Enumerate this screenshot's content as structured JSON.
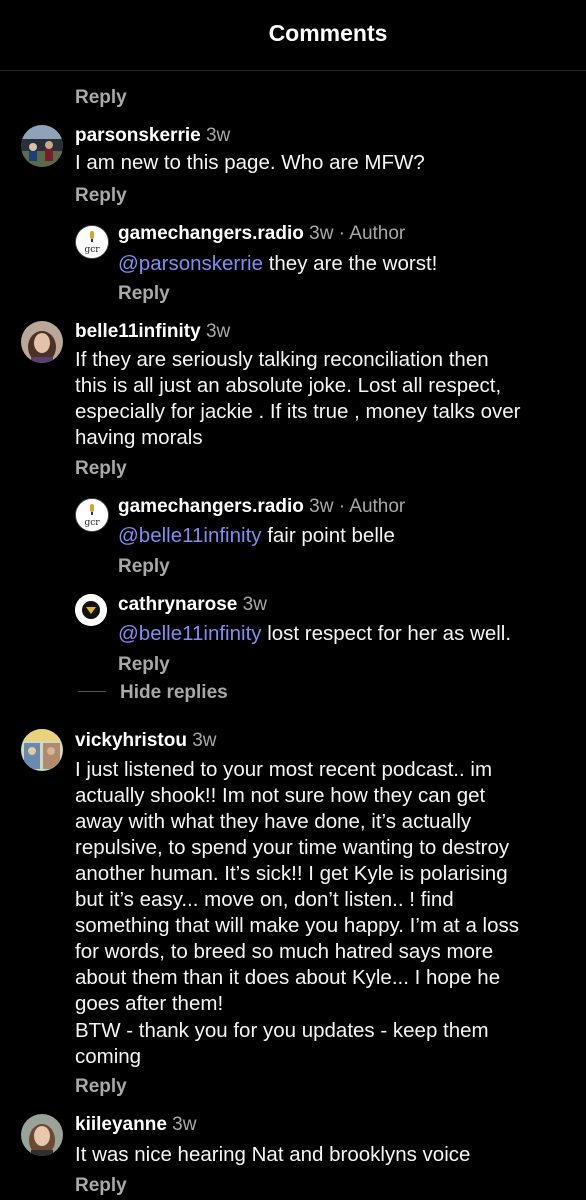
{
  "header": {
    "title": "Comments"
  },
  "reply_label": "Reply",
  "hide_replies_label": "Hide replies",
  "comments": [
    {
      "username": "parsonskerrie",
      "time": "3w",
      "text": "I am new to this page. Who are MFW?"
    },
    {
      "username": "gamechangers.radio",
      "time": "3w",
      "author_badge": "Author",
      "mention": "@parsonskerrie",
      "text": " they are the worst!",
      "avatar_text": "gcr"
    },
    {
      "username": "belle11infinity",
      "time": "3w",
      "text": "If they are seriously talking reconciliation then\nthis is all just an absolute joke. Lost all respect,\nespecially for jackie . If its true , money talks over\nhaving morals"
    },
    {
      "username": "gamechangers.radio",
      "time": "3w",
      "author_badge": "Author",
      "mention": "@belle11infinity",
      "text": " fair point belle",
      "avatar_text": "gcr"
    },
    {
      "username": "cathrynarose",
      "time": "3w",
      "mention": "@belle11infinity",
      "text": " lost respect for her as well."
    },
    {
      "username": "vickyhristou",
      "time": "3w",
      "text": "I just listened to your most recent podcast.. im\nactually shook!! Im not sure how they can get\naway with what they have done, it’s actually\nrepulsive, to spend your time wanting to destroy\nanother human. It’s sick!! I get Kyle is polarising\nbut it’s easy... move on, don’t listen.. ! find\nsomething that will make you happy. I’m at a loss\nfor words, to breed so much hatred says more\nabout them than it does about Kyle... I hope he\ngoes after them!",
      "text2": "BTW - thank you for you updates - keep them\ncoming"
    },
    {
      "username": "kiileyanne",
      "time": "3w",
      "text": "It was nice hearing Nat and brooklyns voice"
    }
  ]
}
